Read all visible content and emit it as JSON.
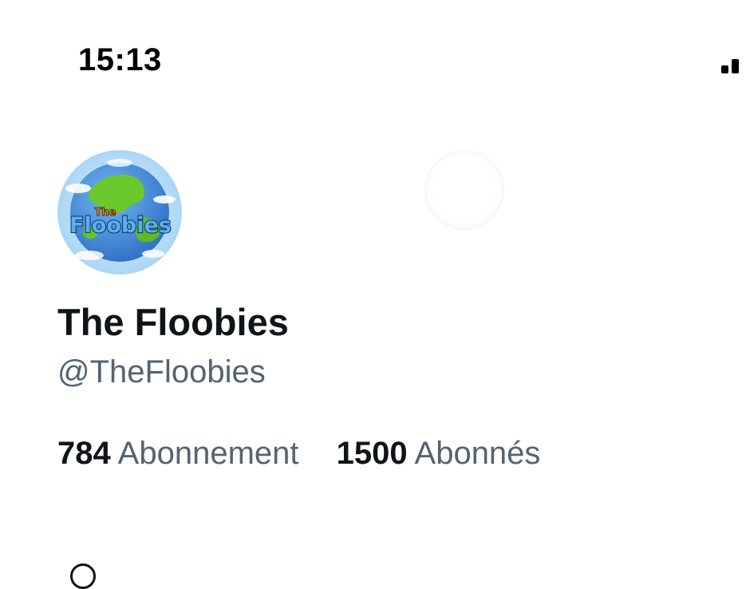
{
  "status_bar": {
    "time": "15:13",
    "signal_icon": "cellular-signal-icon"
  },
  "profile": {
    "avatar_icon": "floobies-globe-logo",
    "avatar_logo_text": "The Floobies",
    "name": "The Floobies",
    "handle": "@TheFloobies",
    "stats": [
      {
        "count": "784",
        "label": "Abonnement"
      },
      {
        "count": "1500",
        "label": "Abonnés"
      }
    ]
  },
  "colors": {
    "primary_text": "#0f1419",
    "secondary_text": "#536471",
    "ocean": "#3f86d6",
    "land": "#6bc92b"
  }
}
